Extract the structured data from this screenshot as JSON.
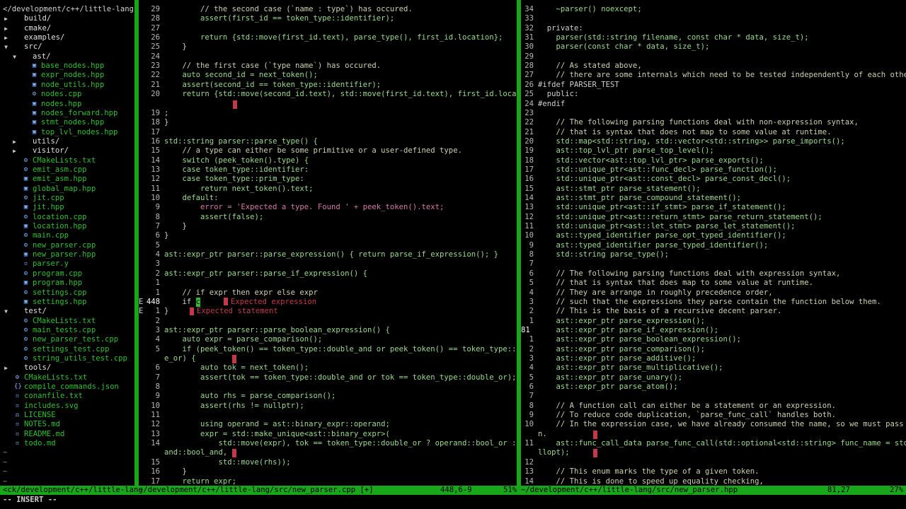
{
  "tree": {
    "root": "</development/c++/little-lang/",
    "items": [
      {
        "indent": 0,
        "arrow": "▶",
        "icon": "",
        "name": "build/",
        "type": "dir"
      },
      {
        "indent": 0,
        "arrow": "▶",
        "icon": "",
        "name": "cmake/",
        "type": "dir"
      },
      {
        "indent": 0,
        "arrow": "▶",
        "icon": "",
        "name": "examples/",
        "type": "dir"
      },
      {
        "indent": 0,
        "arrow": "▼",
        "icon": "",
        "name": "src/",
        "type": "dir"
      },
      {
        "indent": 1,
        "arrow": "▼",
        "icon": "",
        "name": "ast/",
        "type": "dir"
      },
      {
        "indent": 2,
        "arrow": "",
        "icon": "▣",
        "name": "base_nodes.hpp",
        "type": "file"
      },
      {
        "indent": 2,
        "arrow": "",
        "icon": "▣",
        "name": "expr_nodes.hpp",
        "type": "file"
      },
      {
        "indent": 2,
        "arrow": "",
        "icon": "▣",
        "name": "node_utils.hpp",
        "type": "file"
      },
      {
        "indent": 2,
        "arrow": "",
        "icon": "⚙",
        "name": "nodes.cpp",
        "type": "file"
      },
      {
        "indent": 2,
        "arrow": "",
        "icon": "▣",
        "name": "nodes.hpp",
        "type": "file"
      },
      {
        "indent": 2,
        "arrow": "",
        "icon": "▣",
        "name": "nodes_forward.hpp",
        "type": "file"
      },
      {
        "indent": 2,
        "arrow": "",
        "icon": "▣",
        "name": "stmt_nodes.hpp",
        "type": "file"
      },
      {
        "indent": 2,
        "arrow": "",
        "icon": "▣",
        "name": "top_lvl_nodes.hpp",
        "type": "file"
      },
      {
        "indent": 1,
        "arrow": "▶",
        "icon": "",
        "name": "utils/",
        "type": "dir"
      },
      {
        "indent": 1,
        "arrow": "▶",
        "icon": "",
        "name": "visitor/",
        "type": "dir"
      },
      {
        "indent": 1,
        "arrow": "",
        "icon": "⚙",
        "name": "CMakeLists.txt",
        "type": "file"
      },
      {
        "indent": 1,
        "arrow": "",
        "icon": "⚙",
        "name": "emit_asm.cpp",
        "type": "file"
      },
      {
        "indent": 1,
        "arrow": "",
        "icon": "▣",
        "name": "emit_asm.hpp",
        "type": "file"
      },
      {
        "indent": 1,
        "arrow": "",
        "icon": "▣",
        "name": "global_map.hpp",
        "type": "file"
      },
      {
        "indent": 1,
        "arrow": "",
        "icon": "⚙",
        "name": "jit.cpp",
        "type": "file"
      },
      {
        "indent": 1,
        "arrow": "",
        "icon": "▣",
        "name": "jit.hpp",
        "type": "file"
      },
      {
        "indent": 1,
        "arrow": "",
        "icon": "⚙",
        "name": "location.cpp",
        "type": "file"
      },
      {
        "indent": 1,
        "arrow": "",
        "icon": "▣",
        "name": "location.hpp",
        "type": "file"
      },
      {
        "indent": 1,
        "arrow": "",
        "icon": "⚙",
        "name": "main.cpp",
        "type": "file"
      },
      {
        "indent": 1,
        "arrow": "",
        "icon": "⚙",
        "name": "new_parser.cpp",
        "type": "file"
      },
      {
        "indent": 1,
        "arrow": "",
        "icon": "▣",
        "name": "new_parser.hpp",
        "type": "file"
      },
      {
        "indent": 1,
        "arrow": "",
        "icon": "▫",
        "name": "parser.y",
        "type": "file"
      },
      {
        "indent": 1,
        "arrow": "",
        "icon": "⚙",
        "name": "program.cpp",
        "type": "file"
      },
      {
        "indent": 1,
        "arrow": "",
        "icon": "▣",
        "name": "program.hpp",
        "type": "file"
      },
      {
        "indent": 1,
        "arrow": "",
        "icon": "⚙",
        "name": "settings.cpp",
        "type": "file"
      },
      {
        "indent": 1,
        "arrow": "",
        "icon": "▣",
        "name": "settings.hpp",
        "type": "file"
      },
      {
        "indent": 0,
        "arrow": "▼",
        "icon": "",
        "name": "test/",
        "type": "dir"
      },
      {
        "indent": 1,
        "arrow": "",
        "icon": "⚙",
        "name": "CMakeLists.txt",
        "type": "file"
      },
      {
        "indent": 1,
        "arrow": "",
        "icon": "⚙",
        "name": "main_tests.cpp",
        "type": "file"
      },
      {
        "indent": 1,
        "arrow": "",
        "icon": "⚙",
        "name": "new_parser_test.cpp",
        "type": "file"
      },
      {
        "indent": 1,
        "arrow": "",
        "icon": "⚙",
        "name": "settings_test.cpp",
        "type": "file"
      },
      {
        "indent": 1,
        "arrow": "",
        "icon": "⚙",
        "name": "string_utils_test.cpp",
        "type": "file"
      },
      {
        "indent": 0,
        "arrow": "▶",
        "icon": "",
        "name": "tools/",
        "type": "dir"
      },
      {
        "indent": 0,
        "arrow": "",
        "icon": "⚙",
        "name": "CMakeLists.txt",
        "type": "file"
      },
      {
        "indent": 0,
        "arrow": "",
        "icon": "{}",
        "name": "compile_commands.json",
        "type": "file"
      },
      {
        "indent": 0,
        "arrow": "",
        "icon": "▫",
        "name": "conanfile.txt",
        "type": "file"
      },
      {
        "indent": 0,
        "arrow": "",
        "icon": "▫",
        "name": "includes.svg",
        "type": "file"
      },
      {
        "indent": 0,
        "arrow": "",
        "icon": "⚖",
        "name": "LICENSE",
        "type": "file"
      },
      {
        "indent": 0,
        "arrow": "",
        "icon": "▫",
        "name": "NOTES.md",
        "type": "file"
      },
      {
        "indent": 0,
        "arrow": "",
        "icon": "▫",
        "name": "README.md",
        "type": "file"
      },
      {
        "indent": 0,
        "arrow": "",
        "icon": "▫",
        "name": "todo.md",
        "type": "file"
      }
    ],
    "tildes": [
      "~",
      "~",
      "~",
      "~"
    ]
  },
  "left": {
    "lines": [
      {
        "n": "29",
        "s": "",
        "t": "        // the second case (`name : type`) has occured.",
        "c": "cmt"
      },
      {
        "n": "28",
        "s": "",
        "t": "        assert(first_id == token_type::identifier);",
        "c": "green"
      },
      {
        "n": "27",
        "s": "",
        "t": "",
        "c": ""
      },
      {
        "n": "26",
        "s": "",
        "t": "        return {std::move(first_id.text), parse_type(), first_id.location};",
        "c": "green"
      },
      {
        "n": "25",
        "s": "",
        "t": "    }",
        "c": ""
      },
      {
        "n": "24",
        "s": "",
        "t": "",
        "c": ""
      },
      {
        "n": "23",
        "s": "",
        "t": "    // the first case (`type name`) has occured.",
        "c": "cmt"
      },
      {
        "n": "22",
        "s": "",
        "t": "    auto second_id = next_token();",
        "c": "green"
      },
      {
        "n": "21",
        "s": "",
        "t": "    assert(second_id == token_type::identifier);",
        "c": "green"
      },
      {
        "n": "20",
        "s": "",
        "t": "    return {std::move(second_id.text), std::move(first_id.text), first_id.location)",
        "c": "green"
      },
      {
        "n": "",
        "s": "",
        "t": "",
        "c": "",
        "mark": 1
      },
      {
        "n": "19",
        "s": "",
        "t": ";",
        "c": "",
        "wrapped": 1
      },
      {
        "n": "18",
        "s": "",
        "t": "}",
        "c": ""
      },
      {
        "n": "17",
        "s": "",
        "t": "",
        "c": ""
      },
      {
        "n": "16",
        "s": "",
        "t": "std::string parser::parse_type() {",
        "c": "green"
      },
      {
        "n": "15",
        "s": "",
        "t": "    // a type can either be some primitive or a user-defined type.",
        "c": "cmt"
      },
      {
        "n": "14",
        "s": "",
        "t": "    switch (peek_token().type) {",
        "c": "green"
      },
      {
        "n": "13",
        "s": "",
        "t": "    case token_type::identifier:",
        "c": "green"
      },
      {
        "n": "12",
        "s": "",
        "t": "    case token_type::prim_type:",
        "c": "green"
      },
      {
        "n": "11",
        "s": "",
        "t": "        return next_token().text;",
        "c": "green"
      },
      {
        "n": "10",
        "s": "",
        "t": "    default:",
        "c": "green"
      },
      {
        "n": "9",
        "s": "",
        "t": "        error = 'Expected a type. Found ' + peek_token().text;",
        "c": "str"
      },
      {
        "n": "8",
        "s": "",
        "t": "        assert(false);",
        "c": "green"
      },
      {
        "n": "7",
        "s": "",
        "t": "    }",
        "c": ""
      },
      {
        "n": "6",
        "s": "",
        "t": "}",
        "c": ""
      },
      {
        "n": "5",
        "s": "",
        "t": "",
        "c": ""
      },
      {
        "n": "4",
        "s": "",
        "t": "ast::expr_ptr parser::parse_expression() { return parse_if_expression(); }",
        "c": "green"
      },
      {
        "n": "3",
        "s": "",
        "t": "",
        "c": ""
      },
      {
        "n": "2",
        "s": "",
        "t": "ast::expr_ptr parser::parse_if_expression() {",
        "c": "green"
      },
      {
        "n": "1",
        "s": "",
        "t": "",
        "c": ""
      },
      {
        "n": "1",
        "s": "",
        "t": "    // if expr then expr else expr",
        "c": "cmt"
      },
      {
        "n": "448",
        "s": "E",
        "t": "    if ",
        "c": "",
        "cursor": "c",
        "diag": "Expected expression",
        "cur": 1
      },
      {
        "n": "1",
        "s": "E",
        "t": "}",
        "c": "",
        "diag": "Expected statement"
      },
      {
        "n": "2",
        "s": "",
        "t": "",
        "c": ""
      },
      {
        "n": "3",
        "s": "",
        "t": "ast::expr_ptr parser::parse_boolean_expression() {",
        "c": "green"
      },
      {
        "n": "4",
        "s": "",
        "t": "    auto expr = parse_comparison();",
        "c": "green"
      },
      {
        "n": "5",
        "s": "",
        "t": "    if (peek_token() == token_type::double_and or peek_token() == token_type::doubl",
        "c": "green"
      },
      {
        "n": "",
        "s": "",
        "t": "e_or) {",
        "c": "green",
        "wrapped": 1,
        "markAfter": 1
      },
      {
        "n": "6",
        "s": "",
        "t": "        auto tok = next_token();",
        "c": "green"
      },
      {
        "n": "7",
        "s": "",
        "t": "        assert(tok == token_type::double_and or tok == token_type::double_or);",
        "c": "green"
      },
      {
        "n": "8",
        "s": "",
        "t": "",
        "c": ""
      },
      {
        "n": "9",
        "s": "",
        "t": "        auto rhs = parse_comparison();",
        "c": "green"
      },
      {
        "n": "10",
        "s": "",
        "t": "        assert(rhs != nullptr);",
        "c": "green"
      },
      {
        "n": "11",
        "s": "",
        "t": "",
        "c": ""
      },
      {
        "n": "12",
        "s": "",
        "t": "        using operand = ast::binary_expr::operand;",
        "c": "green"
      },
      {
        "n": "13",
        "s": "",
        "t": "        expr = std::make_unique<ast::binary_expr>(",
        "c": "green"
      },
      {
        "n": "14",
        "s": "",
        "t": "            std::move(expr), tok == token_type::double_or ? operand::bool_or : oper",
        "c": "green"
      },
      {
        "n": "",
        "s": "",
        "t": "and::bool_and,",
        "c": "green",
        "wrapped": 1,
        "markAfter": 1
      },
      {
        "n": "15",
        "s": "",
        "t": "            std::move(rhs));",
        "c": "green"
      },
      {
        "n": "16",
        "s": "",
        "t": "    }",
        "c": ""
      },
      {
        "n": "17",
        "s": "",
        "t": "    return expr;",
        "c": "green"
      },
      {
        "n": "18",
        "s": "",
        "t": "}",
        "c": ""
      }
    ]
  },
  "right": {
    "lines": [
      {
        "n": "34",
        "t": "    ~parser() noexcept;",
        "c": "green"
      },
      {
        "n": "33",
        "t": "",
        "c": ""
      },
      {
        "n": "32",
        "t": "  private:",
        "c": ""
      },
      {
        "n": "31",
        "t": "    parser(std::string filename, const char * data, size_t);",
        "c": "green"
      },
      {
        "n": "30",
        "t": "    parser(const char * data, size_t);",
        "c": "green"
      },
      {
        "n": "29",
        "t": "",
        "c": ""
      },
      {
        "n": "28",
        "t": "    // As stated above,",
        "c": "cmt"
      },
      {
        "n": "27",
        "t": "    // there are some internals which need to be tested independently of each other.",
        "c": "cmt"
      },
      {
        "n": "26",
        "t": "#ifdef PARSER_TEST",
        "c": "",
        "nogut": 1
      },
      {
        "n": "25",
        "t": "  public:",
        "c": ""
      },
      {
        "n": "24",
        "t": "#endif",
        "c": "",
        "nogut": 1
      },
      {
        "n": "23",
        "t": "",
        "c": ""
      },
      {
        "n": "22",
        "t": "    // The following parsing functions deal with non-expression syntax,",
        "c": "cmt"
      },
      {
        "n": "21",
        "t": "    // that is syntax that does not map to some value at runtime.",
        "c": "cmt"
      },
      {
        "n": "20",
        "t": "    std::map<std::string, std::vector<std::string>> parse_imports();",
        "c": "green"
      },
      {
        "n": "19",
        "t": "    ast::top_lvl_ptr parse_top_level();",
        "c": "green"
      },
      {
        "n": "18",
        "t": "    std::vector<ast::top_lvl_ptr> parse_exports();",
        "c": "green"
      },
      {
        "n": "17",
        "t": "    std::unique_ptr<ast::func_decl> parse_function();",
        "c": "green"
      },
      {
        "n": "16",
        "t": "    std::unique_ptr<ast::const_decl> parse_const_decl();",
        "c": "green"
      },
      {
        "n": "15",
        "t": "    ast::stmt_ptr parse_statement();",
        "c": "green"
      },
      {
        "n": "14",
        "t": "    ast::stmt_ptr parse_compound_statement();",
        "c": "green"
      },
      {
        "n": "13",
        "t": "    std::unique_ptr<ast::if_stmt> parse_if_statement();",
        "c": "green"
      },
      {
        "n": "12",
        "t": "    std::unique_ptr<ast::return_stmt> parse_return_statement();",
        "c": "green"
      },
      {
        "n": "11",
        "t": "    std::unique_ptr<ast::let_stmt> parse_let_statement();",
        "c": "green"
      },
      {
        "n": "10",
        "t": "    ast::typed_identifier parse_opt_typed_identifier();",
        "c": "green"
      },
      {
        "n": "9",
        "t": "    ast::typed_identifier parse_typed_identifier();",
        "c": "green"
      },
      {
        "n": "8",
        "t": "    std::string parse_type();",
        "c": "green"
      },
      {
        "n": "7",
        "t": "",
        "c": ""
      },
      {
        "n": "6",
        "t": "    // The following parsing functions deal with expression syntax,",
        "c": "cmt"
      },
      {
        "n": "5",
        "t": "    // that is syntax that does map to some value at runtime.",
        "c": "cmt"
      },
      {
        "n": "4",
        "t": "    // They are arrange in roughly precedence order,",
        "c": "cmt"
      },
      {
        "n": "3",
        "t": "    // such that the expressions they parse contain the function below them.",
        "c": "cmt"
      },
      {
        "n": "2",
        "t": "    // This is the basis of a recursive decent parser.",
        "c": "cmt"
      },
      {
        "n": "1",
        "t": "    ast::expr_ptr parse_expression();",
        "c": "green"
      },
      {
        "n": "81",
        "t": "    ast::expr_ptr parse_if_expression();",
        "c": "green",
        "left": 1
      },
      {
        "n": "1",
        "t": "    ast::expr_ptr parse_boolean_expression();",
        "c": "green"
      },
      {
        "n": "2",
        "t": "    ast::expr_ptr parse_comparison();",
        "c": "green"
      },
      {
        "n": "3",
        "t": "    ast::expr_ptr parse_additive();",
        "c": "green"
      },
      {
        "n": "4",
        "t": "    ast::expr_ptr parse_multiplicative();",
        "c": "green"
      },
      {
        "n": "5",
        "t": "    ast::expr_ptr parse_unary();",
        "c": "green"
      },
      {
        "n": "6",
        "t": "    ast::expr_ptr parse_atom();",
        "c": "green"
      },
      {
        "n": "7",
        "t": "",
        "c": ""
      },
      {
        "n": "8",
        "t": "    // A function call can either be a statement or an expression.",
        "c": "cmt"
      },
      {
        "n": "9",
        "t": "    // To reduce code duplication, `parse_func_call` handles both.",
        "c": "cmt"
      },
      {
        "n": "10",
        "t": "    // In the expression case, we have already consumed the name, so we must pass it i",
        "c": "cmt"
      },
      {
        "n": "",
        "t": "n.",
        "c": "cmt",
        "wrapped": 1,
        "markAfter": 1
      },
      {
        "n": "11",
        "t": "    ast::func_call_data parse_func_call(std::optional<std::string> func_name = std::nu",
        "c": "green"
      },
      {
        "n": "",
        "t": "llopt);",
        "c": "green",
        "wrapped": 1,
        "markAfter": 1
      },
      {
        "n": "12",
        "t": "",
        "c": ""
      },
      {
        "n": "13",
        "t": "    // This enum marks the type of a given token.",
        "c": "cmt"
      },
      {
        "n": "14",
        "t": "    // This is done to speed up equality checking,",
        "c": "cmt"
      }
    ]
  },
  "status": {
    "tree_path": "<ck/development/c++/little-lang",
    "file_left": "~/development/c++/little-lang/src/new_parser.cpp [+]",
    "pos_left": "448,6-9",
    "pct_left": "51%",
    "file_right": "~/development/c++/little-lang/src/new_parser.hpp",
    "pos_right": "81,27",
    "pct_right": "27%"
  },
  "mode": "-- INSERT --"
}
